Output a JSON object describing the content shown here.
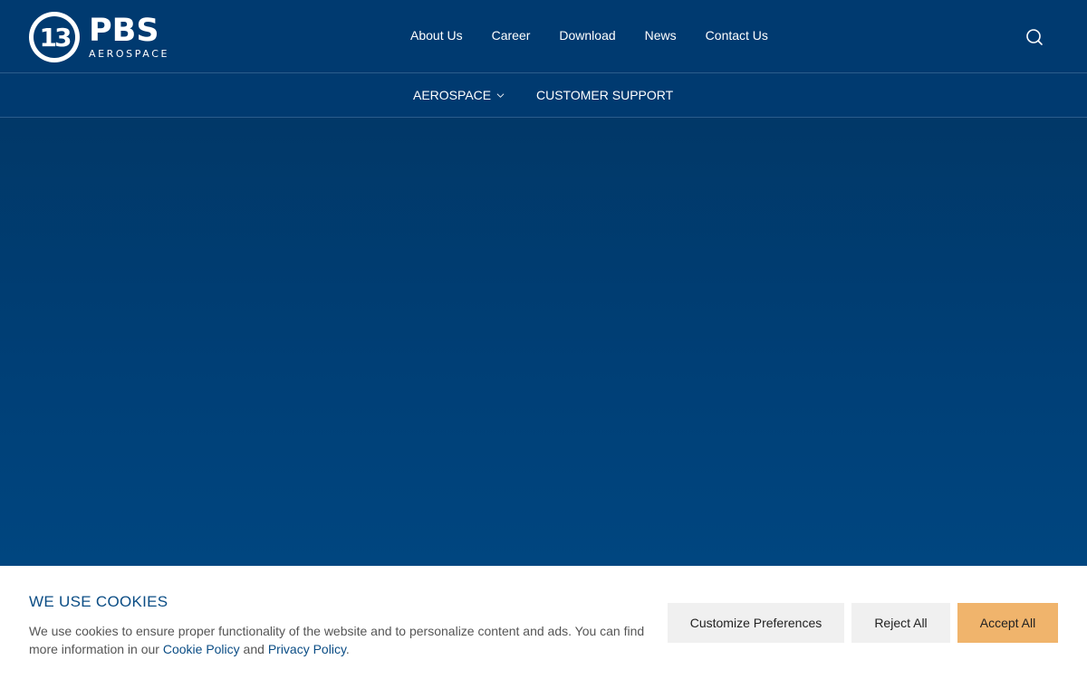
{
  "brand": {
    "badge_text": "13",
    "name": "PBS",
    "subtitle": "AEROSPACE"
  },
  "nav": {
    "items": [
      {
        "label": "About Us"
      },
      {
        "label": "Career"
      },
      {
        "label": "Download"
      },
      {
        "label": "News"
      },
      {
        "label": "Contact Us"
      }
    ],
    "search_icon": "search-icon"
  },
  "subnav": {
    "aerospace": "AEROSPACE",
    "customer_support": "CUSTOMER SUPPORT"
  },
  "cookie_banner": {
    "title": "WE USE COOKIES",
    "text_before": "We use cookies to ensure proper functionality of the website and to personalize content and ads. You can find more information in our ",
    "cookie_policy": "Cookie Policy",
    "and": " and ",
    "privacy_policy": "Privacy Policy",
    "period": ".",
    "customize": "Customize Preferences",
    "reject": "Reject All",
    "accept": "Accept All"
  },
  "colors": {
    "header_bg": "#003a70",
    "accent_button": "#f0b46c",
    "link": "#0b4d85"
  }
}
